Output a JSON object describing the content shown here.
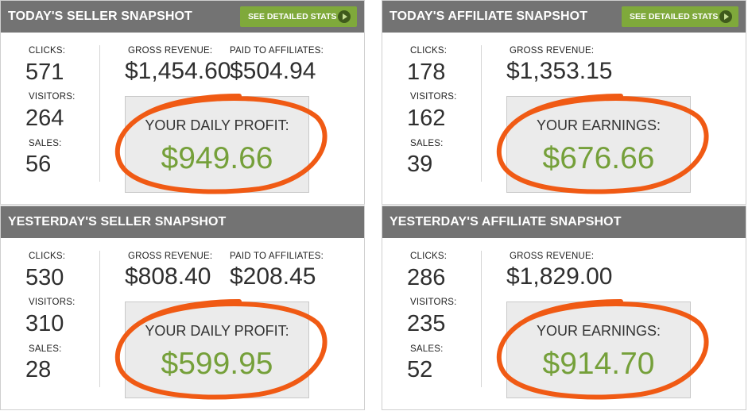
{
  "colors": {
    "header": "#737373",
    "button": "#7fa93b",
    "profit_green": "#75a03a",
    "circle_orange": "#f05a14"
  },
  "panels": [
    {
      "title": "TODAY'S SELLER SNAPSHOT",
      "button": "SEE DETAILED STATS",
      "clicks_label": "CLICKS:",
      "clicks": "571",
      "visitors_label": "VISITORS:",
      "visitors": "264",
      "sales_label": "SALES:",
      "sales": "56",
      "gross_label": "GROSS REVENUE:",
      "gross": "$1,454.60",
      "paid_label": "PAID TO AFFILIATES:",
      "paid": "$504.94",
      "profit_label": "YOUR DAILY PROFIT:",
      "profit": "$949.66"
    },
    {
      "title": "TODAY'S AFFILIATE SNAPSHOT",
      "button": "SEE DETAILED STATS",
      "clicks_label": "CLICKS:",
      "clicks": "178",
      "visitors_label": "VISITORS:",
      "visitors": "162",
      "sales_label": "SALES:",
      "sales": "39",
      "gross_label": "GROSS REVENUE:",
      "gross": "$1,353.15",
      "profit_label": "YOUR EARNINGS:",
      "profit": "$676.66"
    },
    {
      "title": "YESTERDAY'S SELLER SNAPSHOT",
      "clicks_label": "CLICKS:",
      "clicks": "530",
      "visitors_label": "VISITORS:",
      "visitors": "310",
      "sales_label": "SALES:",
      "sales": "28",
      "gross_label": "GROSS REVENUE:",
      "gross": "$808.40",
      "paid_label": "PAID TO AFFILIATES:",
      "paid": "$208.45",
      "profit_label": "YOUR DAILY PROFIT:",
      "profit": "$599.95"
    },
    {
      "title": "YESTERDAY'S AFFILIATE SNAPSHOT",
      "clicks_label": "CLICKS:",
      "clicks": "286",
      "visitors_label": "VISITORS:",
      "visitors": "235",
      "sales_label": "SALES:",
      "sales": "52",
      "gross_label": "GROSS REVENUE:",
      "gross": "$1,829.00",
      "profit_label": "YOUR EARNINGS:",
      "profit": "$914.70"
    }
  ]
}
